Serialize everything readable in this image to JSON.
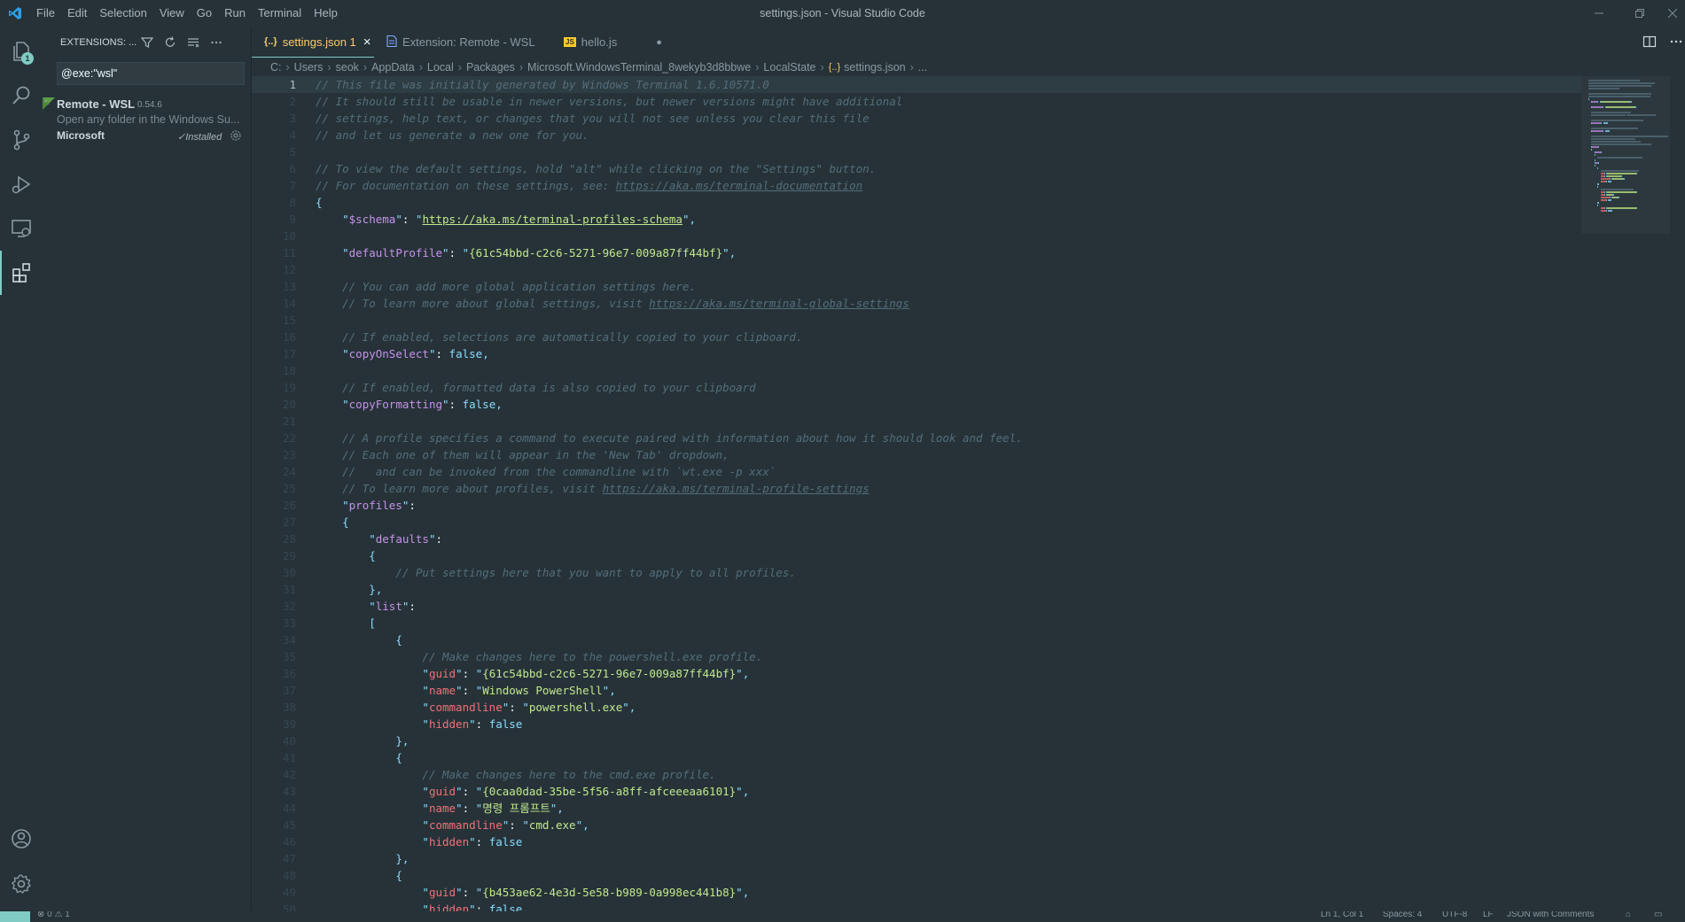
{
  "window": {
    "title": "settings.json - Visual Studio Code"
  },
  "menu": [
    "File",
    "Edit",
    "Selection",
    "View",
    "Go",
    "Run",
    "Terminal",
    "Help"
  ],
  "activity_bar": {
    "explorer_badge": "1"
  },
  "sidebar": {
    "header": "EXTENSIONS: ...",
    "search_value": "@exe:\"wsl\"",
    "extension": {
      "name": "Remote - WSL",
      "version": "0.54.6",
      "description": "Open any folder in the Windows Su...",
      "publisher": "Microsoft",
      "status": "Installed"
    }
  },
  "tabs": [
    {
      "label": "settings.json 1",
      "icon": "{..}",
      "active": true,
      "close": "×"
    },
    {
      "label": "Extension: Remote - WSL",
      "icon": "",
      "active": false
    },
    {
      "label": "hello.js",
      "icon": "JS",
      "active": false,
      "dirty": "●"
    }
  ],
  "breadcrumb": [
    "C:",
    "Users",
    "seok",
    "AppData",
    "Local",
    "Packages",
    "Microsoft.WindowsTerminal_8wekyb3d8bbwe",
    "LocalState",
    "settings.json",
    "..."
  ],
  "editor": {
    "current_line": 1,
    "lines": [
      [
        [
          "c-com",
          "// This file was initially generated by Windows Terminal 1.6.10571.0"
        ]
      ],
      [
        [
          "c-com",
          "// It should still be usable in newer versions, but newer versions might have additional"
        ]
      ],
      [
        [
          "c-com",
          "// settings, help text, or changes that you will not see unless you clear this file"
        ]
      ],
      [
        [
          "c-com",
          "// and let us generate a new one for you."
        ]
      ],
      [],
      [
        [
          "c-com",
          "// To view the default settings, hold \"alt\" while clicking on the \"Settings\" button."
        ]
      ],
      [
        [
          "c-com",
          "// For documentation on these settings, see: "
        ],
        [
          "c-url",
          "https://aka.ms/terminal-documentation"
        ]
      ],
      [
        [
          "c-punc",
          "{"
        ]
      ],
      [
        [
          "c-plain",
          "    "
        ],
        [
          "c-q",
          "\""
        ],
        [
          "c-key",
          "$schema"
        ],
        [
          "c-q",
          "\""
        ],
        [
          "c-plain",
          ": "
        ],
        [
          "c-q",
          "\""
        ],
        [
          "c-surl",
          "https://aka.ms/terminal-profiles-schema"
        ],
        [
          "c-q",
          "\""
        ],
        [
          "c-punc",
          ","
        ]
      ],
      [],
      [
        [
          "c-plain",
          "    "
        ],
        [
          "c-q",
          "\""
        ],
        [
          "c-key",
          "defaultProfile"
        ],
        [
          "c-q",
          "\""
        ],
        [
          "c-plain",
          ": "
        ],
        [
          "c-q",
          "\""
        ],
        [
          "c-str",
          "{61c54bbd-c2c6-5271-96e7-009a87ff44bf}"
        ],
        [
          "c-q",
          "\""
        ],
        [
          "c-punc",
          ","
        ]
      ],
      [],
      [
        [
          "c-plain",
          "    "
        ],
        [
          "c-com",
          "// You can add more global application settings here."
        ]
      ],
      [
        [
          "c-plain",
          "    "
        ],
        [
          "c-com",
          "// To learn more about global settings, visit "
        ],
        [
          "c-url",
          "https://aka.ms/terminal-global-settings"
        ]
      ],
      [],
      [
        [
          "c-plain",
          "    "
        ],
        [
          "c-com",
          "// If enabled, selections are automatically copied to your clipboard."
        ]
      ],
      [
        [
          "c-plain",
          "    "
        ],
        [
          "c-q",
          "\""
        ],
        [
          "c-key",
          "copyOnSelect"
        ],
        [
          "c-q",
          "\""
        ],
        [
          "c-plain",
          ": "
        ],
        [
          "c-bool",
          "false"
        ],
        [
          "c-punc",
          ","
        ]
      ],
      [],
      [
        [
          "c-plain",
          "    "
        ],
        [
          "c-com",
          "// If enabled, formatted data is also copied to your clipboard"
        ]
      ],
      [
        [
          "c-plain",
          "    "
        ],
        [
          "c-q",
          "\""
        ],
        [
          "c-key",
          "copyFormatting"
        ],
        [
          "c-q",
          "\""
        ],
        [
          "c-plain",
          ": "
        ],
        [
          "c-bool",
          "false"
        ],
        [
          "c-punc",
          ","
        ]
      ],
      [],
      [
        [
          "c-plain",
          "    "
        ],
        [
          "c-com",
          "// A profile specifies a command to execute paired with information about how it should look and feel."
        ]
      ],
      [
        [
          "c-plain",
          "    "
        ],
        [
          "c-com",
          "// Each one of them will appear in the 'New Tab' dropdown,"
        ]
      ],
      [
        [
          "c-plain",
          "    "
        ],
        [
          "c-com",
          "//   and can be invoked from the commandline with `wt.exe -p xxx`"
        ]
      ],
      [
        [
          "c-plain",
          "    "
        ],
        [
          "c-com",
          "// To learn more about profiles, visit "
        ],
        [
          "c-url",
          "https://aka.ms/terminal-profile-settings"
        ]
      ],
      [
        [
          "c-plain",
          "    "
        ],
        [
          "c-q",
          "\""
        ],
        [
          "c-key",
          "profiles"
        ],
        [
          "c-q",
          "\""
        ],
        [
          "c-plain",
          ":"
        ]
      ],
      [
        [
          "c-plain",
          "    "
        ],
        [
          "c-punc",
          "{"
        ]
      ],
      [
        [
          "c-plain",
          "        "
        ],
        [
          "c-q",
          "\""
        ],
        [
          "c-key",
          "defaults"
        ],
        [
          "c-q",
          "\""
        ],
        [
          "c-plain",
          ":"
        ]
      ],
      [
        [
          "c-plain",
          "        "
        ],
        [
          "c-punc",
          "{"
        ]
      ],
      [
        [
          "c-plain",
          "            "
        ],
        [
          "c-com",
          "// Put settings here that you want to apply to all profiles."
        ]
      ],
      [
        [
          "c-plain",
          "        "
        ],
        [
          "c-punc",
          "},"
        ]
      ],
      [
        [
          "c-plain",
          "        "
        ],
        [
          "c-q",
          "\""
        ],
        [
          "c-key",
          "list"
        ],
        [
          "c-q",
          "\""
        ],
        [
          "c-plain",
          ":"
        ]
      ],
      [
        [
          "c-plain",
          "        "
        ],
        [
          "c-punc",
          "["
        ]
      ],
      [
        [
          "c-plain",
          "            "
        ],
        [
          "c-punc",
          "{"
        ]
      ],
      [
        [
          "c-plain",
          "                "
        ],
        [
          "c-com",
          "// Make changes here to the powershell.exe profile."
        ]
      ],
      [
        [
          "c-plain",
          "                "
        ],
        [
          "c-q",
          "\""
        ],
        [
          "c-prop",
          "guid"
        ],
        [
          "c-q",
          "\""
        ],
        [
          "c-plain",
          ": "
        ],
        [
          "c-q",
          "\""
        ],
        [
          "c-str",
          "{61c54bbd-c2c6-5271-96e7-009a87ff44bf}"
        ],
        [
          "c-q",
          "\""
        ],
        [
          "c-punc",
          ","
        ]
      ],
      [
        [
          "c-plain",
          "                "
        ],
        [
          "c-q",
          "\""
        ],
        [
          "c-prop",
          "name"
        ],
        [
          "c-q",
          "\""
        ],
        [
          "c-plain",
          ": "
        ],
        [
          "c-q",
          "\""
        ],
        [
          "c-str",
          "Windows PowerShell"
        ],
        [
          "c-q",
          "\""
        ],
        [
          "c-punc",
          ","
        ]
      ],
      [
        [
          "c-plain",
          "                "
        ],
        [
          "c-q",
          "\""
        ],
        [
          "c-prop",
          "commandline"
        ],
        [
          "c-q",
          "\""
        ],
        [
          "c-plain",
          ": "
        ],
        [
          "c-q",
          "\""
        ],
        [
          "c-str",
          "powershell.exe"
        ],
        [
          "c-q",
          "\""
        ],
        [
          "c-punc",
          ","
        ]
      ],
      [
        [
          "c-plain",
          "                "
        ],
        [
          "c-q",
          "\""
        ],
        [
          "c-prop",
          "hidden"
        ],
        [
          "c-q",
          "\""
        ],
        [
          "c-plain",
          ": "
        ],
        [
          "c-bool",
          "false"
        ]
      ],
      [
        [
          "c-plain",
          "            "
        ],
        [
          "c-punc",
          "},"
        ]
      ],
      [
        [
          "c-plain",
          "            "
        ],
        [
          "c-punc",
          "{"
        ]
      ],
      [
        [
          "c-plain",
          "                "
        ],
        [
          "c-com",
          "// Make changes here to the cmd.exe profile."
        ]
      ],
      [
        [
          "c-plain",
          "                "
        ],
        [
          "c-q",
          "\""
        ],
        [
          "c-prop",
          "guid"
        ],
        [
          "c-q",
          "\""
        ],
        [
          "c-plain",
          ": "
        ],
        [
          "c-q",
          "\""
        ],
        [
          "c-str",
          "{0caa0dad-35be-5f56-a8ff-afceeeaa6101}"
        ],
        [
          "c-q",
          "\""
        ],
        [
          "c-punc",
          ","
        ]
      ],
      [
        [
          "c-plain",
          "                "
        ],
        [
          "c-q",
          "\""
        ],
        [
          "c-prop",
          "name"
        ],
        [
          "c-q",
          "\""
        ],
        [
          "c-plain",
          ": "
        ],
        [
          "c-q",
          "\""
        ],
        [
          "c-str",
          "명령 프롬프트"
        ],
        [
          "c-q",
          "\""
        ],
        [
          "c-punc",
          ","
        ]
      ],
      [
        [
          "c-plain",
          "                "
        ],
        [
          "c-q",
          "\""
        ],
        [
          "c-prop",
          "commandline"
        ],
        [
          "c-q",
          "\""
        ],
        [
          "c-plain",
          ": "
        ],
        [
          "c-q",
          "\""
        ],
        [
          "c-str",
          "cmd.exe"
        ],
        [
          "c-q",
          "\""
        ],
        [
          "c-punc",
          ","
        ]
      ],
      [
        [
          "c-plain",
          "                "
        ],
        [
          "c-q",
          "\""
        ],
        [
          "c-prop",
          "hidden"
        ],
        [
          "c-q",
          "\""
        ],
        [
          "c-plain",
          ": "
        ],
        [
          "c-bool",
          "false"
        ]
      ],
      [
        [
          "c-plain",
          "            "
        ],
        [
          "c-punc",
          "},"
        ]
      ],
      [
        [
          "c-plain",
          "            "
        ],
        [
          "c-punc",
          "{"
        ]
      ],
      [
        [
          "c-plain",
          "                "
        ],
        [
          "c-q",
          "\""
        ],
        [
          "c-prop",
          "guid"
        ],
        [
          "c-q",
          "\""
        ],
        [
          "c-plain",
          ": "
        ],
        [
          "c-q",
          "\""
        ],
        [
          "c-str",
          "{b453ae62-4e3d-5e58-b989-0a998ec441b8}"
        ],
        [
          "c-q",
          "\""
        ],
        [
          "c-punc",
          ","
        ]
      ],
      [
        [
          "c-plain",
          "                "
        ],
        [
          "c-q",
          "\""
        ],
        [
          "c-prop",
          "hidden"
        ],
        [
          "c-q",
          "\""
        ],
        [
          "c-plain",
          ": "
        ],
        [
          "c-bool",
          "false"
        ],
        [
          "c-punc",
          ","
        ]
      ]
    ]
  },
  "statusbar": {
    "problems": "⊗ 0 ⚠ 1",
    "position": "Ln 1, Col 1",
    "spaces": "Spaces: 4",
    "encoding": "UTF-8",
    "eol": "LF",
    "language": "JSON with Comments"
  },
  "colors": {
    "background": "#263238",
    "accent": "#80cbc4",
    "comment": "#546e7a",
    "key": "#c792ea",
    "string": "#c3e88d",
    "property": "#f07178"
  }
}
